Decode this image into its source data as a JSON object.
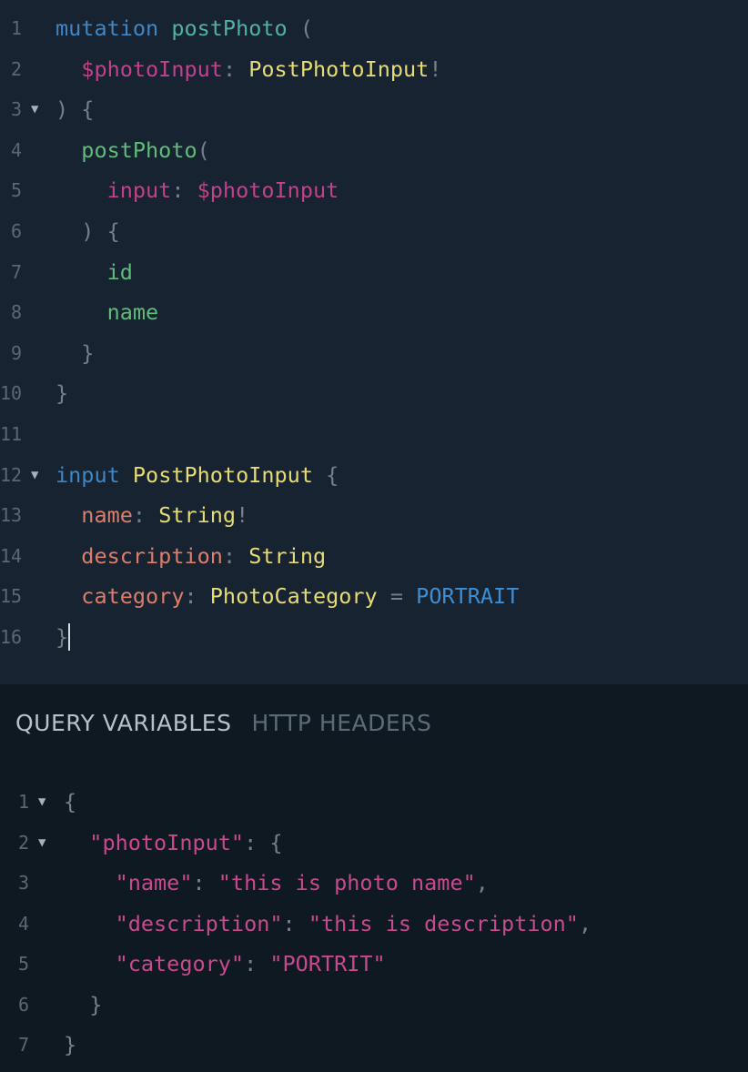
{
  "query_editor": {
    "lines": [
      {
        "n": "1",
        "tokens": [
          {
            "c": "kw",
            "t": "mutation"
          },
          {
            "c": "punc",
            "t": " "
          },
          {
            "c": "def",
            "t": "postPhoto"
          },
          {
            "c": "punc",
            "t": " ("
          }
        ]
      },
      {
        "n": "2",
        "tokens": [
          {
            "c": "punc",
            "t": "  "
          },
          {
            "c": "var",
            "t": "$photoInput"
          },
          {
            "c": "punc",
            "t": ": "
          },
          {
            "c": "type",
            "t": "PostPhotoInput"
          },
          {
            "c": "punc",
            "t": "!"
          }
        ]
      },
      {
        "n": "3",
        "fold": true,
        "tokens": [
          {
            "c": "punc",
            "t": ") {"
          }
        ]
      },
      {
        "n": "4",
        "tokens": [
          {
            "c": "punc",
            "t": "  "
          },
          {
            "c": "field",
            "t": "postPhoto"
          },
          {
            "c": "punc",
            "t": "("
          }
        ]
      },
      {
        "n": "5",
        "tokens": [
          {
            "c": "punc",
            "t": "    "
          },
          {
            "c": "arg",
            "t": "input"
          },
          {
            "c": "punc",
            "t": ": "
          },
          {
            "c": "var",
            "t": "$photoInput"
          }
        ]
      },
      {
        "n": "6",
        "tokens": [
          {
            "c": "punc",
            "t": "  ) {"
          }
        ]
      },
      {
        "n": "7",
        "tokens": [
          {
            "c": "punc",
            "t": "    "
          },
          {
            "c": "field",
            "t": "id"
          }
        ]
      },
      {
        "n": "8",
        "tokens": [
          {
            "c": "punc",
            "t": "    "
          },
          {
            "c": "field",
            "t": "name"
          }
        ]
      },
      {
        "n": "9",
        "tokens": [
          {
            "c": "punc",
            "t": "  }"
          }
        ]
      },
      {
        "n": "10",
        "tokens": [
          {
            "c": "punc",
            "t": "}"
          }
        ]
      },
      {
        "n": "11",
        "tokens": []
      },
      {
        "n": "12",
        "fold": true,
        "tokens": [
          {
            "c": "kw",
            "t": "input"
          },
          {
            "c": "punc",
            "t": " "
          },
          {
            "c": "type",
            "t": "PostPhotoInput"
          },
          {
            "c": "punc",
            "t": " {"
          }
        ]
      },
      {
        "n": "13",
        "tokens": [
          {
            "c": "punc",
            "t": "  "
          },
          {
            "c": "pfield",
            "t": "name"
          },
          {
            "c": "punc",
            "t": ": "
          },
          {
            "c": "type",
            "t": "String"
          },
          {
            "c": "punc",
            "t": "!"
          }
        ]
      },
      {
        "n": "14",
        "tokens": [
          {
            "c": "punc",
            "t": "  "
          },
          {
            "c": "pfield",
            "t": "description"
          },
          {
            "c": "punc",
            "t": ": "
          },
          {
            "c": "type",
            "t": "String"
          }
        ]
      },
      {
        "n": "15",
        "tokens": [
          {
            "c": "punc",
            "t": "  "
          },
          {
            "c": "pfield",
            "t": "category"
          },
          {
            "c": "punc",
            "t": ": "
          },
          {
            "c": "type",
            "t": "PhotoCategory"
          },
          {
            "c": "punc",
            "t": " = "
          },
          {
            "c": "enum",
            "t": "PORTRAIT"
          }
        ]
      },
      {
        "n": "16",
        "cursor": true,
        "tokens": [
          {
            "c": "punc",
            "t": "}"
          }
        ]
      }
    ]
  },
  "tabs": {
    "query_variables": "QUERY VARIABLES",
    "http_headers": "HTTP HEADERS"
  },
  "variables_editor": {
    "lines": [
      {
        "n": "1",
        "fold": true,
        "tokens": [
          {
            "c": "punc",
            "t": "{"
          }
        ]
      },
      {
        "n": "2",
        "fold": true,
        "tokens": [
          {
            "c": "punc",
            "t": "  "
          },
          {
            "c": "key",
            "t": "\"photoInput\""
          },
          {
            "c": "punc",
            "t": ": {"
          }
        ]
      },
      {
        "n": "3",
        "tokens": [
          {
            "c": "punc",
            "t": "    "
          },
          {
            "c": "key",
            "t": "\"name\""
          },
          {
            "c": "punc",
            "t": ": "
          },
          {
            "c": "str",
            "t": "\"this is photo name\""
          },
          {
            "c": "punc",
            "t": ","
          }
        ]
      },
      {
        "n": "4",
        "tokens": [
          {
            "c": "punc",
            "t": "    "
          },
          {
            "c": "key",
            "t": "\"description\""
          },
          {
            "c": "punc",
            "t": ": "
          },
          {
            "c": "str",
            "t": "\"this is description\""
          },
          {
            "c": "punc",
            "t": ","
          }
        ]
      },
      {
        "n": "5",
        "tokens": [
          {
            "c": "punc",
            "t": "    "
          },
          {
            "c": "key",
            "t": "\"category\""
          },
          {
            "c": "punc",
            "t": ": "
          },
          {
            "c": "str",
            "t": "\"PORTRIT\""
          }
        ]
      },
      {
        "n": "6",
        "tokens": [
          {
            "c": "punc",
            "t": "  }"
          }
        ]
      },
      {
        "n": "7",
        "tokens": [
          {
            "c": "punc",
            "t": "}"
          }
        ]
      }
    ]
  },
  "colors": {
    "editor_bg": "#172330",
    "lower_bg": "#0f1922",
    "keyword": "#3f86c6",
    "type": "#e6db74",
    "variable": "#c1418a",
    "field": "#5fbc7a",
    "input_field": "#dd7d6a",
    "enum": "#3e8ed4"
  }
}
